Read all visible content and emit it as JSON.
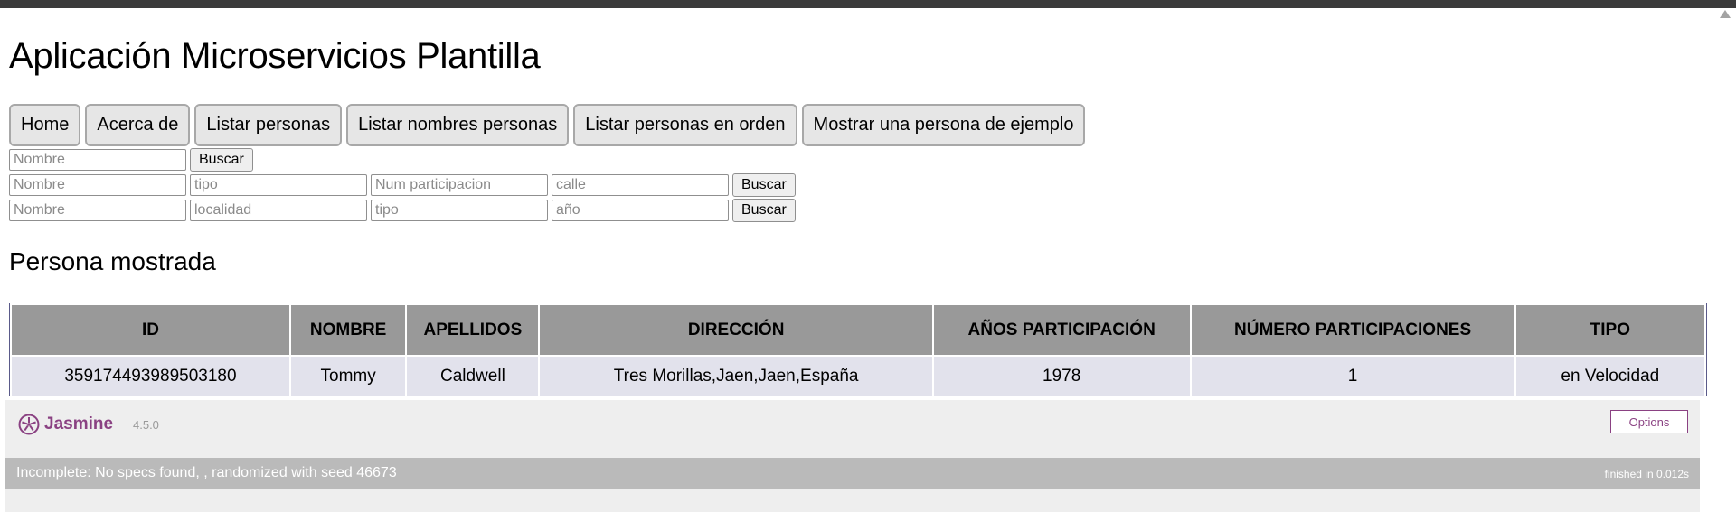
{
  "app": {
    "title": "Aplicación Microservicios Plantilla"
  },
  "nav": [
    "Home",
    "Acerca de",
    "Listar personas",
    "Listar nombres personas",
    "Listar personas en orden",
    "Mostrar una persona de ejemplo"
  ],
  "search_forms": [
    {
      "placeholders": [
        "Nombre"
      ],
      "button": "Buscar"
    },
    {
      "placeholders": [
        "Nombre",
        "tipo",
        "Num participacion",
        "calle"
      ],
      "button": "Buscar"
    },
    {
      "placeholders": [
        "Nombre",
        "localidad",
        "tipo",
        "año"
      ],
      "button": "Buscar"
    }
  ],
  "section": {
    "title": "Persona mostrada"
  },
  "table": {
    "headers": [
      "ID",
      "NOMBRE",
      "APELLIDOS",
      "DIRECCIÓN",
      "AÑOS PARTICIPACIÓN",
      "NÚMERO PARTICIPACIONES",
      "TIPO"
    ],
    "rows": [
      [
        "359174493989503180",
        "Tommy",
        "Caldwell",
        "Tres Morillas,Jaen,Jaen,España",
        "1978",
        "1",
        "en Velocidad"
      ]
    ]
  },
  "jasmine": {
    "logo_text": "Jasmine",
    "version": "4.5.0",
    "options_label": "Options",
    "status_text": "Incomplete: No specs found, , randomized with seed",
    "seed": "46673",
    "duration": "finished in 0.012s"
  },
  "colors": {
    "header_bg": "#999999",
    "cell_bg": "#e2e2ec",
    "jasmine_accent": "#8a4182",
    "status_bar": "#bababa"
  }
}
